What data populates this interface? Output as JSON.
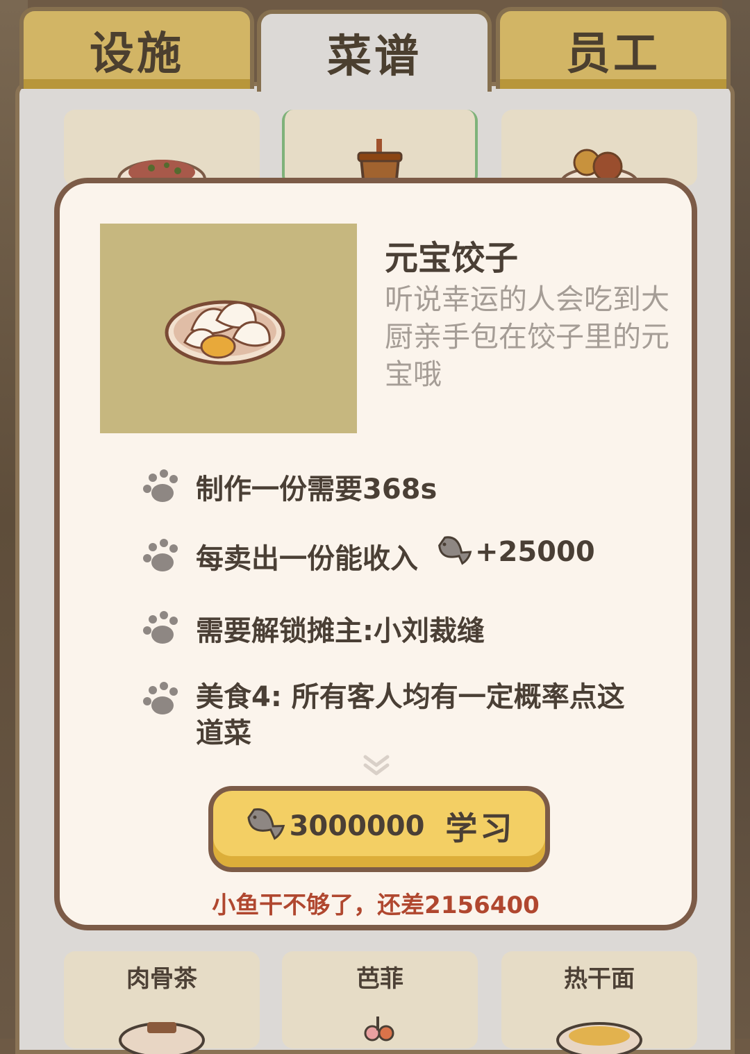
{
  "tabs": [
    {
      "label": "设施",
      "active": false
    },
    {
      "label": "菜谱",
      "active": true
    },
    {
      "label": "员工",
      "active": false
    }
  ],
  "grid_bottom": [
    {
      "label": "肉骨茶"
    },
    {
      "label": "芭菲"
    },
    {
      "label": "热干面"
    }
  ],
  "dish": {
    "name": "元宝饺子",
    "description": "听说幸运的人会吃到大厨亲手包在饺子里的元宝哦",
    "info": {
      "time": "制作一份需要368s",
      "income_label": "每卖出一份能收入",
      "income_value": "+25000",
      "unlock": "需要解锁摊主:小刘裁缝",
      "effect": "美食4: 所有客人均有一定概率点这道菜"
    }
  },
  "learn_button": {
    "price": "3000000",
    "label": "学习"
  },
  "warning": "小鱼干不够了，还差2156400",
  "colors": {
    "tab_gold": "#d2b565",
    "modal_bg": "#fbf4ec",
    "modal_border": "#7c5b47",
    "button_yellow": "#f3cf64",
    "warning_red": "#b0472f"
  },
  "icons": [
    "paw-icon",
    "dried-fish-icon",
    "double-chevron-down-icon"
  ]
}
